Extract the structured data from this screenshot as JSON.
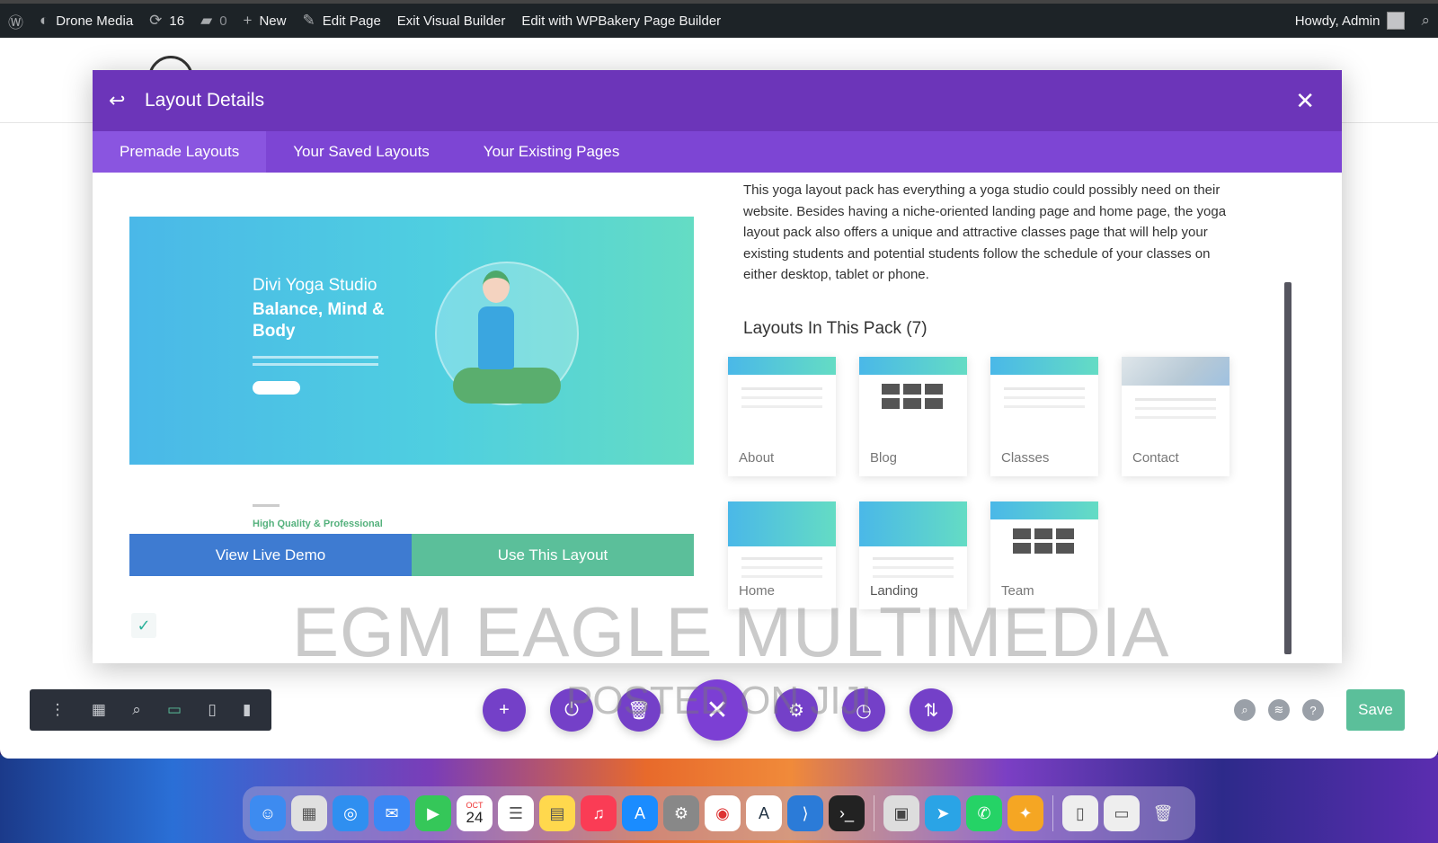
{
  "adminbar": {
    "site_name": "Drone Media",
    "updates_count": "16",
    "comments_count": "0",
    "new_label": "New",
    "edit_page_label": "Edit Page",
    "exit_builder_label": "Exit Visual Builder",
    "wpbakery_label": "Edit with WPBakery Page Builder",
    "howdy_label": "Howdy, Admin"
  },
  "modal": {
    "title": "Layout Details",
    "tabs": [
      {
        "label": "Premade Layouts",
        "active": true
      },
      {
        "label": "Your Saved Layouts",
        "active": false
      },
      {
        "label": "Your Existing Pages",
        "active": false
      }
    ],
    "preview": {
      "hero_subtitle": "Divi Yoga Studio",
      "hero_title": "Balance, Mind & Body",
      "section_heading": "High Quality & Professional"
    },
    "view_demo_label": "View Live Demo",
    "use_layout_label": "Use This Layout",
    "description": "This yoga layout pack has everything a yoga studio could possibly need on their website. Besides having a niche-oriented landing page and home page, the yoga layout pack also offers a unique and attractive classes page that will help your existing students and potential students follow the schedule of your classes on either desktop, tablet or phone.",
    "pack_title": "Layouts In This Pack (7)",
    "layouts": [
      "About",
      "Blog",
      "Classes",
      "Contact",
      "Home",
      "Landing",
      "Team"
    ]
  },
  "watermark": {
    "line1": "EGM EAGLE MULTIMEDIA",
    "line2": "POSTED ON JIJI"
  },
  "builder": {
    "save_label": "Save"
  },
  "dock": {
    "calendar_month": "OCT",
    "calendar_day": "24"
  },
  "colors": {
    "modal_header": "#6c35b9",
    "tab_bar": "#7d45d4",
    "demo_button": "#3e7bd1",
    "use_button": "#5bbf9a",
    "save_button": "#5bbf9a",
    "admin_bar": "#1d2327"
  }
}
